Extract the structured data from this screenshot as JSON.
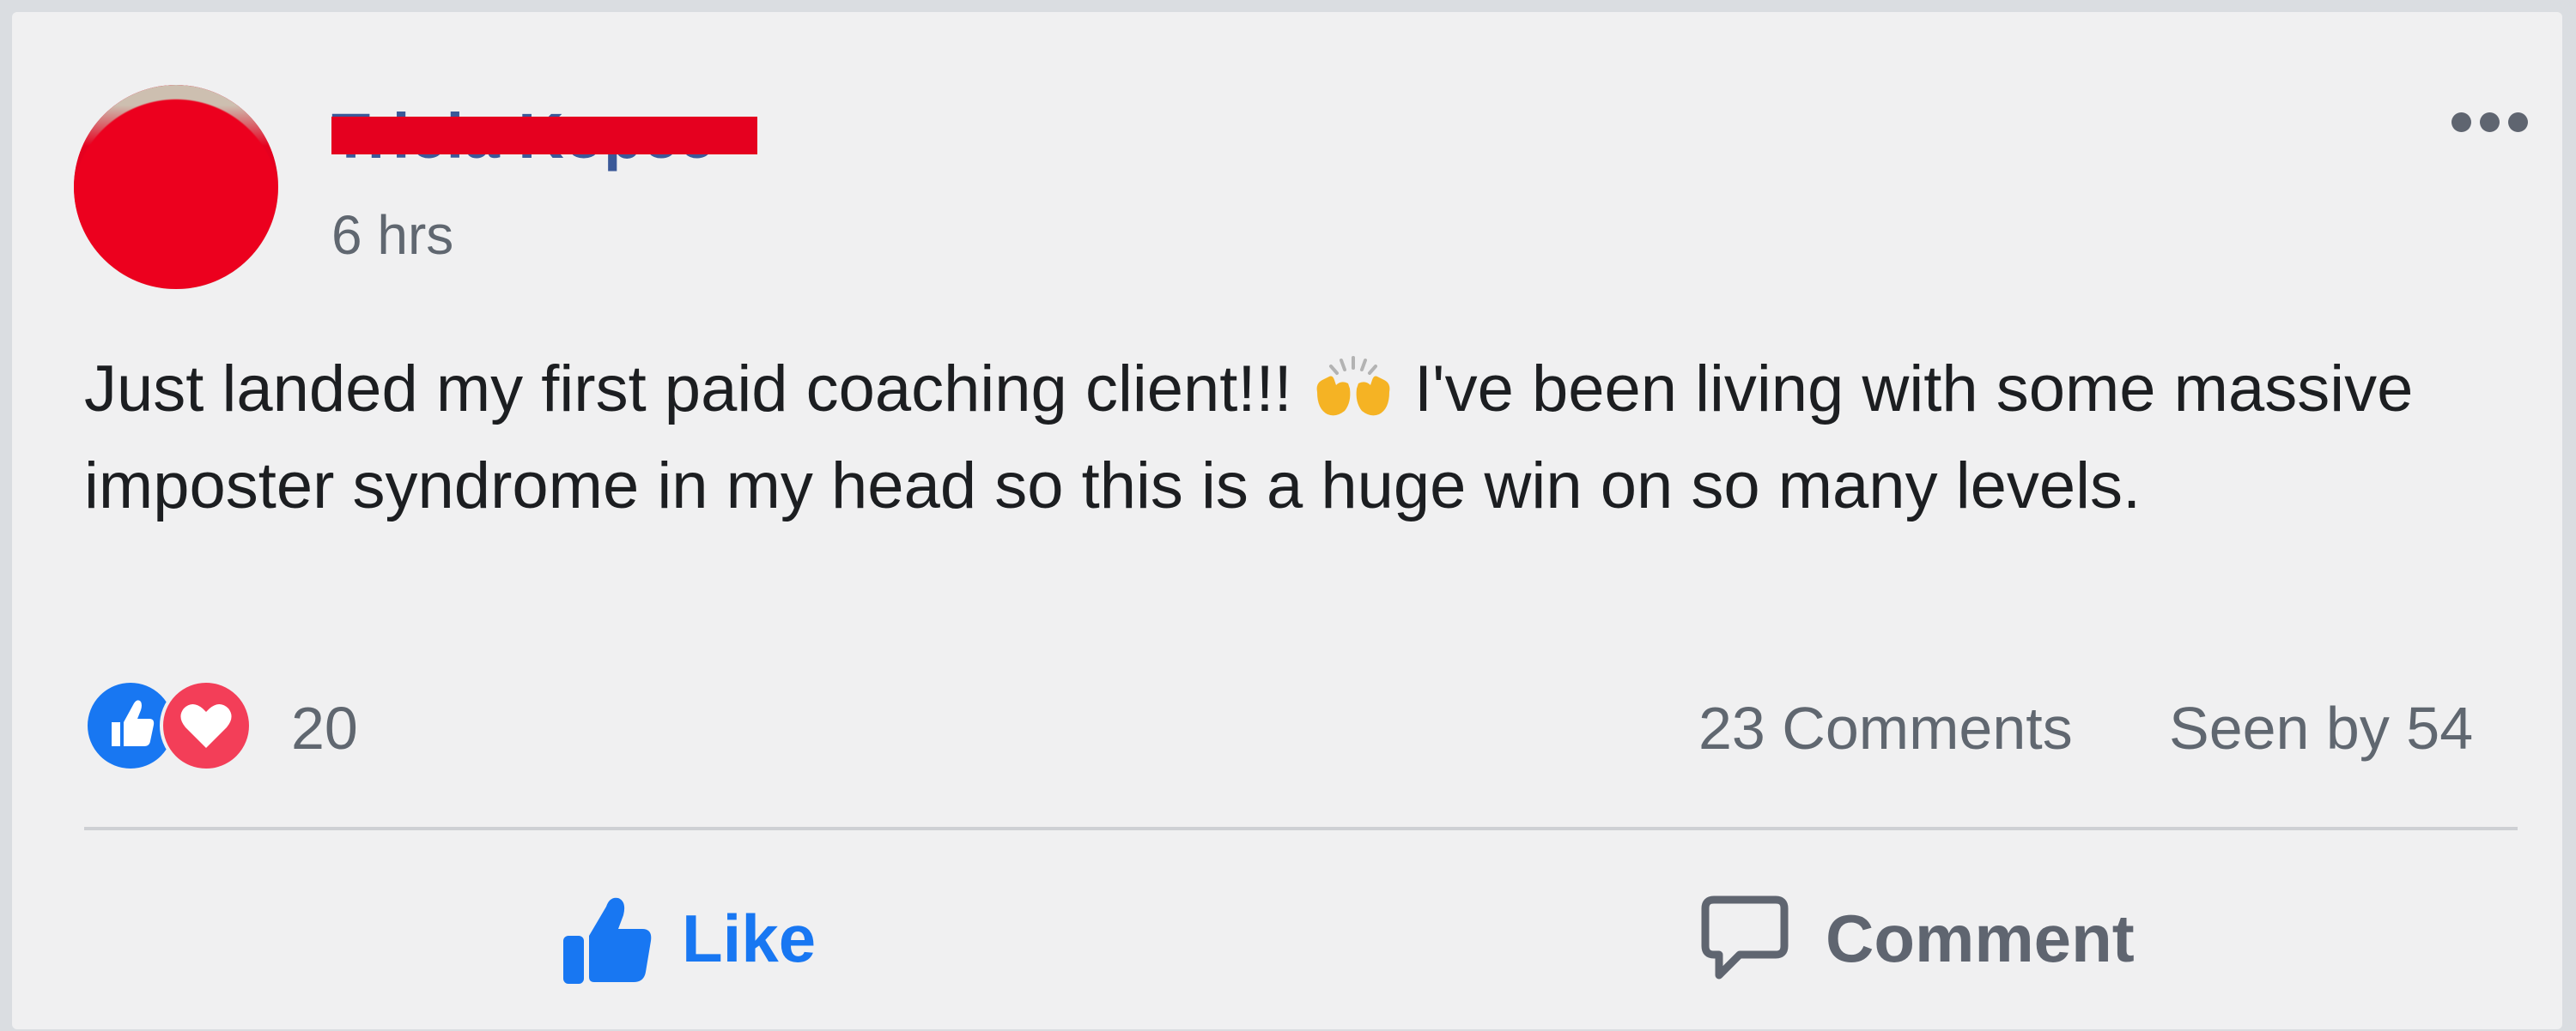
{
  "post": {
    "author_name": "Tricia Kopec",
    "timestamp": "6 hrs",
    "text_parts": [
      "Just landed my first paid coaching client!!! ",
      " I've been living with some massive imposter syndrome in my head so this is a huge win on so many levels."
    ],
    "inline_emoji": "raising-hands-emoji"
  },
  "stats": {
    "reaction_count": "20",
    "comments": "23 Comments",
    "seen_by": "Seen by 54"
  },
  "actions": {
    "like_label": "Like",
    "comment_label": "Comment"
  },
  "icons": {
    "more": "more-options-icon",
    "reaction_like": "like-reaction-icon",
    "reaction_love": "love-reaction-icon",
    "like_button": "thumbs-up-icon",
    "comment_button": "speech-bubble-icon"
  },
  "colors": {
    "brand_blue": "#1877f2",
    "love_red": "#f33e58",
    "redaction_red": "#e5001f",
    "secondary_text": "#606770",
    "primary_text": "#1c1e21",
    "card_bg": "#f0f0f1"
  }
}
